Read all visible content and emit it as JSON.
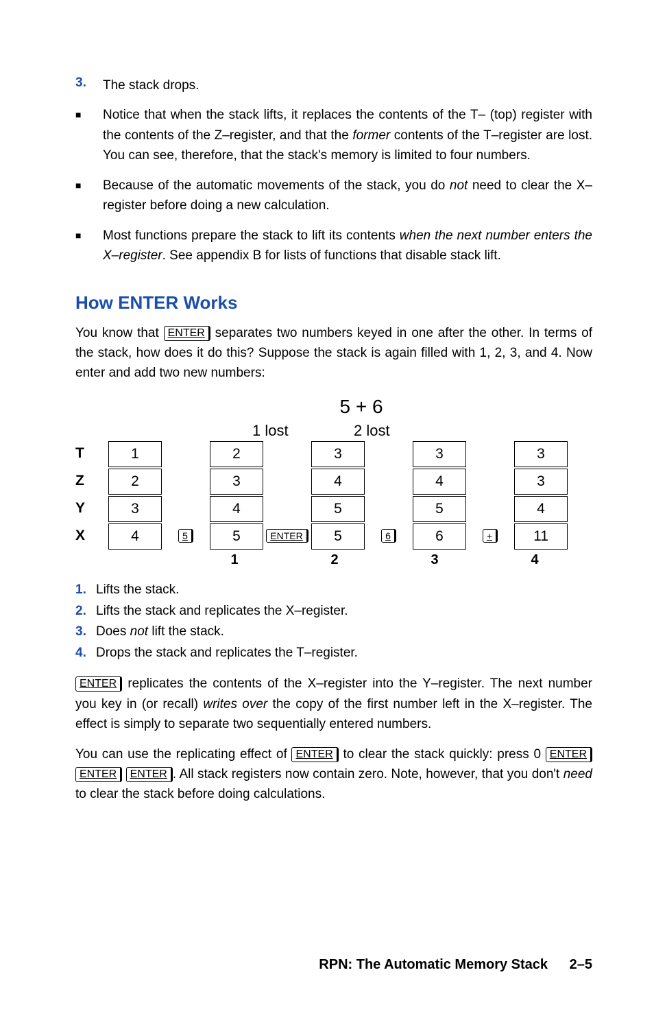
{
  "top_list": {
    "n3_marker": "3.",
    "n3_text": "The stack drops.",
    "b1_text_a": "Notice that when the stack lifts, it replaces the contents of the T– (top) register with the contents of the Z–register, and that the ",
    "b1_former": "former",
    "b1_text_b": " contents of the T–register are lost. You can see, therefore, that the stack's memory is limited to four numbers.",
    "b2_text_a": "Because of the automatic movements of the stack, you do ",
    "b2_not": "not",
    "b2_text_b": " need to clear the X–register before doing a new calculation.",
    "b3_text_a": "Most functions prepare the stack to lift its contents ",
    "b3_when": "when the next number enters the X–register",
    "b3_text_b": ". See appendix B for lists of functions that disable stack lift."
  },
  "h2": "How ENTER Works",
  "p1_a": "You know that ",
  "p1_enter": "ENTER",
  "p1_b": " separates two numbers keyed in one after the other. In terms of the stack, how does it do this? Suppose the stack is again filled with 1, 2, 3, and 4. Now enter and add two new numbers:",
  "diagram": {
    "expr": "5 + 6",
    "lost1": "1 lost",
    "lost2": "2 lost",
    "rows": [
      "T",
      "Z",
      "Y",
      "X"
    ],
    "col1": [
      "1",
      "2",
      "3",
      "4"
    ],
    "col2": [
      "2",
      "3",
      "4",
      "5"
    ],
    "col3": [
      "3",
      "4",
      "5",
      "5"
    ],
    "col4": [
      "3",
      "4",
      "5",
      "6"
    ],
    "col5": [
      "3",
      "3",
      "4",
      "11"
    ],
    "key1": "5",
    "key2": "ENTER",
    "key3": "6",
    "key4": "+",
    "steps": [
      "1",
      "2",
      "3",
      "4"
    ]
  },
  "ol": {
    "m1": "1.",
    "t1": "Lifts the stack.",
    "m2": "2.",
    "t2": "Lifts the stack and replicates the X–register.",
    "m3": "3.",
    "t3_a": "Does ",
    "t3_not": "not",
    "t3_b": " lift the stack.",
    "m4": "4.",
    "t4": "Drops the stack and replicates the T–register."
  },
  "p2_enter": "ENTER",
  "p2_a": " replicates the contents of the X–register into the Y–register. The next number you key in (or recall) ",
  "p2_writes": "writes over",
  "p2_b": " the copy of the first number left in the X–register. The effect is simply to separate two sequentially entered numbers.",
  "p3_a": "You can use the replicating effect of ",
  "p3_enter": "ENTER",
  "p3_b": " to clear the stack quickly: press 0 ",
  "p3_c": ". All stack registers now contain zero. Note, however, that you don't ",
  "p3_need": "need",
  "p3_d": " to clear the stack before doing calculations.",
  "footer_title": "RPN: The Automatic Memory Stack",
  "footer_page": "2–5"
}
